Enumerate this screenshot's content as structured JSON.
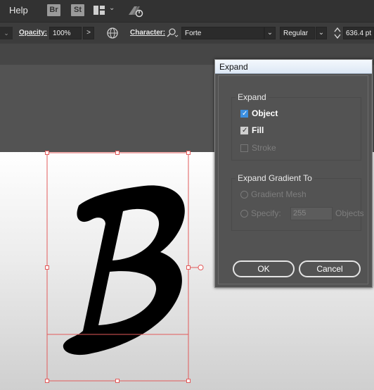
{
  "menubar": {
    "help_label": "Help",
    "bridge_label": "Br",
    "stock_label": "St",
    "workspace_icon": "grid-layout-icon",
    "sync_icon": "gpu-sync-icon"
  },
  "controlbar": {
    "opacity_label": "Opacity:",
    "opacity_value": "100%",
    "character_label": "Character:",
    "font_name": "Forte",
    "font_style": "Regular",
    "font_size": "636.4 pt",
    "more_arrow": ">",
    "dropdown_arrow": "⌄"
  },
  "canvas": {
    "glyph": "B",
    "selection_color": "#e25a5a"
  },
  "dialog": {
    "title": "Expand",
    "expand_group": {
      "title": "Expand",
      "object_label": "Object",
      "object_checked": true,
      "fill_label": "Fill",
      "fill_checked": true,
      "stroke_label": "Stroke",
      "stroke_checked": false
    },
    "gradient_group": {
      "title": "Expand Gradient To",
      "mesh_label": "Gradient Mesh",
      "specify_label": "Specify:",
      "specify_value": "255",
      "objects_label": "Objects"
    },
    "ok_label": "OK",
    "cancel_label": "Cancel"
  }
}
